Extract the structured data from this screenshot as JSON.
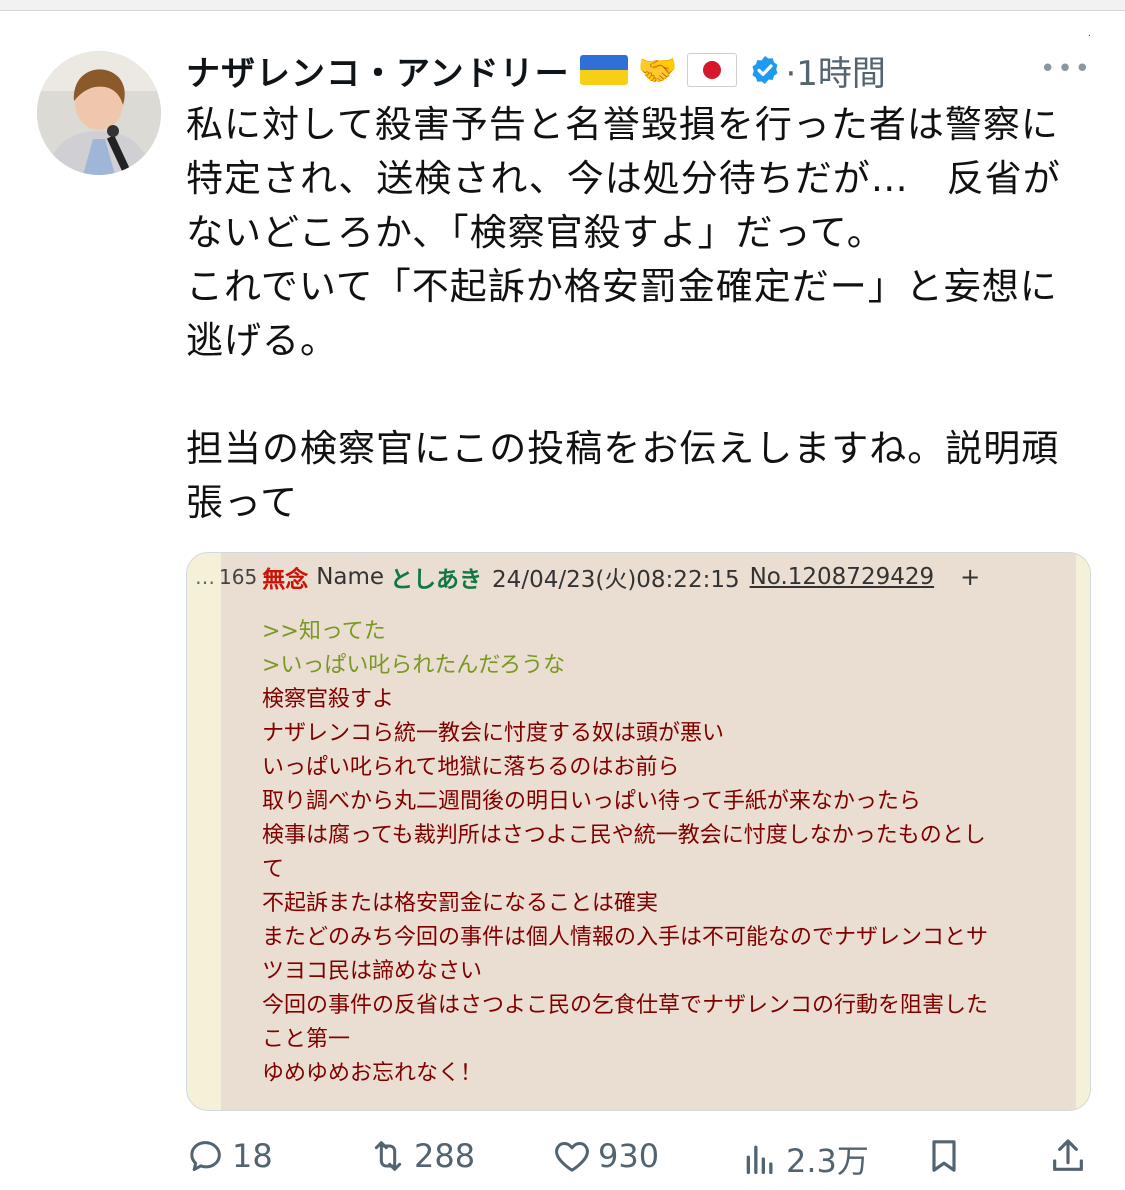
{
  "window": {
    "corner_mark": "."
  },
  "tweet": {
    "author_name": "ナザレンコ・アンドリー",
    "time": "·1時間",
    "more_label": "•••",
    "text_lines": [
      "私に対して殺害予告と名誉毀損を行った者は警察に",
      "特定され、送検され、今は処分待ちだが…　反省が",
      "ないどころか、「検察官殺すよ」だって。",
      "これでいて「不起訴か格安罰金確定だー」と妄想に",
      "逃げる。",
      "",
      "担当の検察官にこの投稿をお伝えしますね。説明頑",
      "張って"
    ]
  },
  "embedded_post": {
    "dots": "…",
    "number": "165",
    "title": "無念",
    "name_label": "Name",
    "username": "としあき",
    "date": "24/04/23(火)08:22:15",
    "post_no": "No.1208729429",
    "plus": "+",
    "quotes": [
      ">>知ってた",
      ">いっぱい叱られたんだろうな"
    ],
    "lines": [
      "検察官殺すよ",
      "ナザレンコら統一教会に忖度する奴は頭が悪い",
      "いっぱい叱られて地獄に落ちるのはお前ら",
      "取り調べから丸二週間後の明日いっぱい待って手紙が来なかったら",
      "検事は腐っても裁判所はさつよこ民や統一教会に忖度しなかったものとし",
      "て",
      "不起訴または格安罰金になることは確実",
      "またどのみち今回の事件は個人情報の入手は不可能なのでナザレンコとサ",
      "ツヨコ民は諦めなさい",
      "今回の事件の反省はさつよこ民の乞食仕草でナザレンコの行動を阻害した",
      "こと第一",
      "ゆめゆめお忘れなく！"
    ]
  },
  "actions": {
    "replies": "18",
    "reposts": "288",
    "likes": "930",
    "views": "2.3万"
  },
  "colors": {
    "accent": "#1d9bf0",
    "muted": "#536471",
    "quote_green": "#789922",
    "post_maroon": "#800000",
    "title_red": "#cc1105",
    "user_green": "#117743",
    "card_bg": "#eaded2"
  },
  "icons": {
    "verified": "verified-badge-icon",
    "reply": "reply-icon",
    "repost": "repost-icon",
    "like": "heart-icon",
    "views": "views-chart-icon",
    "bookmark": "bookmark-icon",
    "share": "share-icon"
  }
}
